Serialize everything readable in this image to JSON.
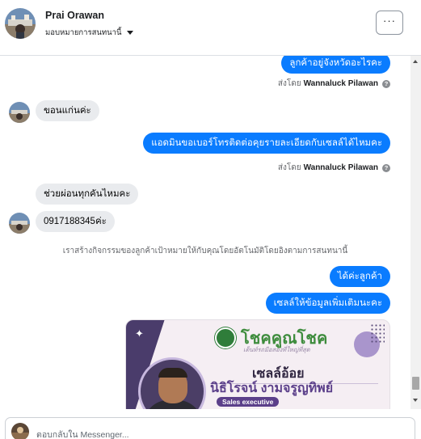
{
  "header": {
    "contact_name": "Prai Orawan",
    "assign_label": "มอบหมายการสนทนานี้",
    "more_button": "···"
  },
  "messages": [
    {
      "direction": "out",
      "text": "ลูกค้าอยู่จังหวัดอะไรคะ"
    },
    {
      "type": "meta",
      "prefix": "ส่งโดย",
      "sender": "Wannaluck Pilawan"
    },
    {
      "direction": "in",
      "text": "ขอนแก่นค่ะ"
    },
    {
      "direction": "out",
      "text": "แอดมินขอเบอร์โทรติดต่อคุยรายละเอียดกับเซลล์ได้ไหมคะ"
    },
    {
      "type": "meta",
      "prefix": "ส่งโดย",
      "sender": "Wannaluck Pilawan"
    },
    {
      "direction": "in",
      "text": "ช่วยผ่อนทุกคันไหมคะ"
    },
    {
      "direction": "in",
      "text": "0917188345ค่ะ"
    },
    {
      "type": "system",
      "text": "เราสร้างกิจกรรมของลูกค้าเป้าหมายให้กับคุณโดยอัตโนมัติโดยอิงตามการสนทนานี้"
    },
    {
      "direction": "out",
      "text": "ได้ค่ะลูกค้า"
    },
    {
      "direction": "out",
      "text": "เซลล์ให้ข้อมูลเพิ่มเติมนะคะ"
    }
  ],
  "image_card": {
    "brand": "โชคคูณโชค",
    "tagline": "เต็นท์รถมือสองที่ใหญ่ที่สุด",
    "title": "เซลล์อ้อย",
    "fullname": "นิธิโรจน์  งามจรูญทิพย์",
    "role": "Sales executive"
  },
  "footer": {
    "reply_placeholder": "ตอบกลับใน Messenger..."
  },
  "colors": {
    "outgoing_bubble": "#0a7cff",
    "incoming_bubble": "#e9ebee",
    "card_accent": "#5b3f8a"
  }
}
